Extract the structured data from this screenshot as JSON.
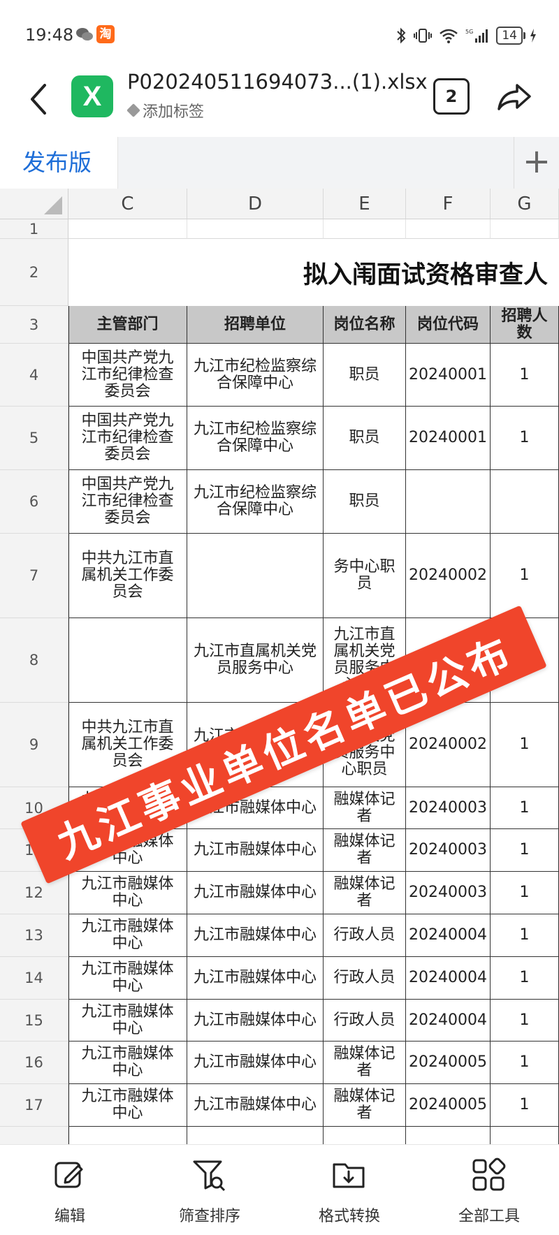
{
  "status_bar": {
    "time": "19:48",
    "battery": "14"
  },
  "app_bar": {
    "filename": "P020240511694073...(1).xlsx",
    "tag_label": "添加标签",
    "tab_count": "2"
  },
  "sheet_tabs": {
    "active": "发布版"
  },
  "columns": [
    "C",
    "D",
    "E",
    "F",
    "G"
  ],
  "sheet_title": "拟入闱面试资格审查人",
  "table": {
    "headers": [
      "主管部门",
      "招聘单位",
      "岗位名称",
      "岗位代码",
      "招聘人数"
    ],
    "rows": [
      {
        "row": "4",
        "cells": [
          "中国共产党九江市纪律检查委员会",
          "九江市纪检监察综合保障中心",
          "职员",
          "20240001",
          "1"
        ]
      },
      {
        "row": "5",
        "cells": [
          "中国共产党九江市纪律检查委员会",
          "九江市纪检监察综合保障中心",
          "职员",
          "20240001",
          "1"
        ]
      },
      {
        "row": "6",
        "cells": [
          "中国共产党九江市纪律检查委员会",
          "九江市纪检监察综合保障中心",
          "职员",
          "",
          ""
        ]
      },
      {
        "row": "7",
        "cells": [
          "中共九江市直属机关工作委员会",
          "",
          "务中心职员",
          "20240002",
          "1"
        ]
      },
      {
        "row": "8",
        "cells": [
          "",
          "九江市直属机关党员服务中心",
          "九江市直属机关党员服务中心职员",
          "20240002",
          "1"
        ]
      },
      {
        "row": "9",
        "cells": [
          "中共九江市直属机关工作委员会",
          "九江市直属机关党员服务中心",
          "九江市直属机关党员服务中心职员",
          "20240002",
          "1"
        ]
      },
      {
        "row": "10",
        "cells": [
          "九江市融媒体中心",
          "九江市融媒体中心",
          "融媒体记者",
          "20240003",
          "1"
        ]
      },
      {
        "row": "11",
        "cells": [
          "九江市融媒体中心",
          "九江市融媒体中心",
          "融媒体记者",
          "20240003",
          "1"
        ]
      },
      {
        "row": "12",
        "cells": [
          "九江市融媒体中心",
          "九江市融媒体中心",
          "融媒体记者",
          "20240003",
          "1"
        ]
      },
      {
        "row": "13",
        "cells": [
          "九江市融媒体中心",
          "九江市融媒体中心",
          "行政人员",
          "20240004",
          "1"
        ]
      },
      {
        "row": "14",
        "cells": [
          "九江市融媒体中心",
          "九江市融媒体中心",
          "行政人员",
          "20240004",
          "1"
        ]
      },
      {
        "row": "15",
        "cells": [
          "九江市融媒体中心",
          "九江市融媒体中心",
          "行政人员",
          "20240004",
          "1"
        ]
      },
      {
        "row": "16",
        "cells": [
          "九江市融媒体中心",
          "九江市融媒体中心",
          "融媒体记者",
          "20240005",
          "1"
        ]
      },
      {
        "row": "17",
        "cells": [
          "九江市融媒体中心",
          "九江市融媒体中心",
          "融媒体记者",
          "20240005",
          "1"
        ]
      }
    ]
  },
  "overlay_banner": "九江事业单位名单已公布",
  "bottom_toolbar": [
    {
      "label": "编辑",
      "icon": "edit-icon"
    },
    {
      "label": "筛查排序",
      "icon": "filter-search-icon"
    },
    {
      "label": "格式转换",
      "icon": "folder-download-icon"
    },
    {
      "label": "全部工具",
      "icon": "all-tools-grid-icon"
    }
  ],
  "colors": {
    "accent": "#1e6ed8",
    "excel": "#1fb860",
    "banner": "#f0452b",
    "header_fill": "#c8c8c8"
  }
}
